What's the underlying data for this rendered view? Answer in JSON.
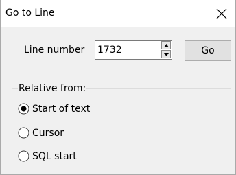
{
  "window": {
    "title": "Go to Line"
  },
  "form": {
    "line_label": "Line number",
    "line_value": "1732",
    "go_label": "Go"
  },
  "relative": {
    "group_label": "Relative from:",
    "options": [
      {
        "label": "Start of text",
        "selected": true
      },
      {
        "label": "Cursor",
        "selected": false
      },
      {
        "label": "SQL start",
        "selected": false
      }
    ]
  },
  "icons": {
    "close": "close-icon",
    "spin_up": "chevron-up-icon",
    "spin_down": "chevron-down-icon"
  },
  "colors": {
    "dialog_bg": "#f0f0f0",
    "titlebar_bg": "#ffffff",
    "button_bg": "#e1e1e1"
  }
}
